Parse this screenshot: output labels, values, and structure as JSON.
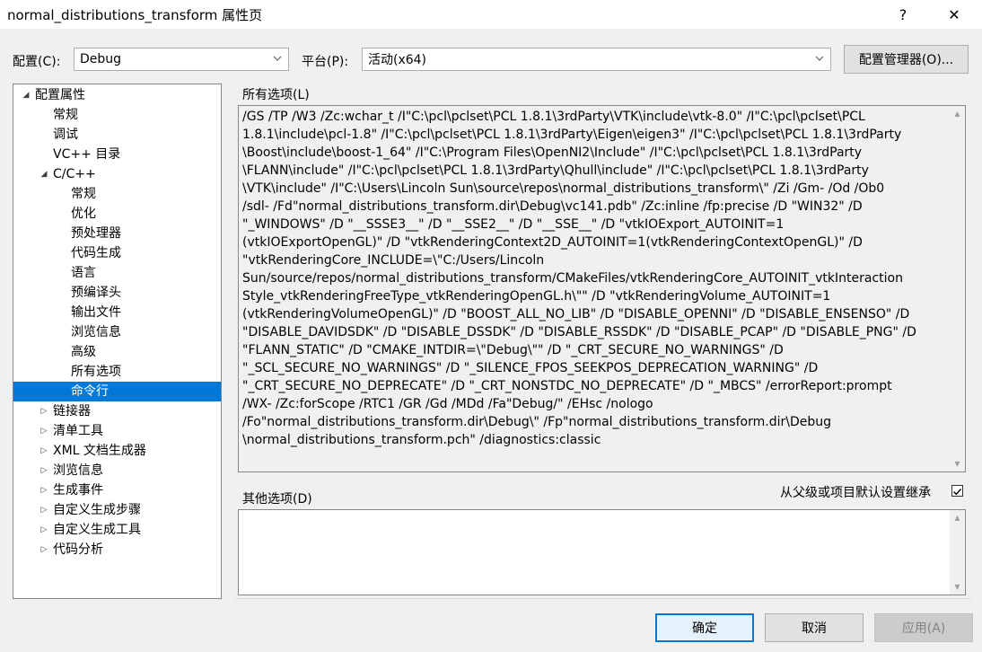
{
  "window": {
    "title": "normal_distributions_transform 属性页",
    "help_label": "?",
    "close_label": "✕"
  },
  "config": {
    "label": "配置(C):",
    "value": "Debug"
  },
  "platform": {
    "label": "平台(P):",
    "value": "活动(x64)"
  },
  "config_manager_label": "配置管理器(O)...",
  "tree": [
    {
      "label": "配置属性",
      "level": 0,
      "exp": "◢"
    },
    {
      "label": "常规",
      "level": 1
    },
    {
      "label": "调试",
      "level": 1
    },
    {
      "label": "VC++ 目录",
      "level": 1
    },
    {
      "label": "C/C++",
      "level": 1,
      "exp": "◢"
    },
    {
      "label": "常规",
      "level": 2
    },
    {
      "label": "优化",
      "level": 2
    },
    {
      "label": "预处理器",
      "level": 2
    },
    {
      "label": "代码生成",
      "level": 2
    },
    {
      "label": "语言",
      "level": 2
    },
    {
      "label": "预编译头",
      "level": 2
    },
    {
      "label": "输出文件",
      "level": 2
    },
    {
      "label": "浏览信息",
      "level": 2
    },
    {
      "label": "高级",
      "level": 2
    },
    {
      "label": "所有选项",
      "level": 2
    },
    {
      "label": "命令行",
      "level": 2,
      "selected": true
    },
    {
      "label": "链接器",
      "level": 1,
      "exp": "▷"
    },
    {
      "label": "清单工具",
      "level": 1,
      "exp": "▷"
    },
    {
      "label": "XML 文档生成器",
      "level": 1,
      "exp": "▷"
    },
    {
      "label": "浏览信息",
      "level": 1,
      "exp": "▷"
    },
    {
      "label": "生成事件",
      "level": 1,
      "exp": "▷"
    },
    {
      "label": "自定义生成步骤",
      "level": 1,
      "exp": "▷"
    },
    {
      "label": "自定义生成工具",
      "level": 1,
      "exp": "▷"
    },
    {
      "label": "代码分析",
      "level": 1,
      "exp": "▷"
    }
  ],
  "all_options": {
    "label": "所有选项(L)",
    "lines": [
      "/GS /TP /W3 /Zc:wchar_t /I\"C:\\pcl\\pclset\\PCL 1.8.1\\3rdParty\\VTK\\include\\vtk-8.0\" /I\"C:\\pcl\\pclset\\PCL",
      "1.8.1\\include\\pcl-1.8\" /I\"C:\\pcl\\pclset\\PCL 1.8.1\\3rdParty\\Eigen\\eigen3\" /I\"C:\\pcl\\pclset\\PCL 1.8.1\\3rdParty",
      "\\Boost\\include\\boost-1_64\" /I\"C:\\Program Files\\OpenNI2\\Include\" /I\"C:\\pcl\\pclset\\PCL 1.8.1\\3rdParty",
      "\\FLANN\\include\" /I\"C:\\pcl\\pclset\\PCL 1.8.1\\3rdParty\\Qhull\\include\" /I\"C:\\pcl\\pclset\\PCL 1.8.1\\3rdParty",
      "\\VTK\\include\" /I\"C:\\Users\\Lincoln Sun\\source\\repos\\normal_distributions_transform\\\" /Zi /Gm- /Od /Ob0",
      "/sdl- /Fd\"normal_distributions_transform.dir\\Debug\\vc141.pdb\" /Zc:inline /fp:precise /D \"WIN32\" /D",
      "\"_WINDOWS\" /D \"__SSSE3__\" /D \"__SSE2__\" /D \"__SSE__\" /D \"vtkIOExport_AUTOINIT=1",
      "(vtkIOExportOpenGL)\" /D \"vtkRenderingContext2D_AUTOINIT=1(vtkRenderingContextOpenGL)\" /D",
      "\"vtkRenderingCore_INCLUDE=\\\"C:/Users/Lincoln",
      "Sun/source/repos/normal_distributions_transform/CMakeFiles/vtkRenderingCore_AUTOINIT_vtkInteraction",
      "Style_vtkRenderingFreeType_vtkRenderingOpenGL.h\\\"\" /D \"vtkRenderingVolume_AUTOINIT=1",
      "(vtkRenderingVolumeOpenGL)\" /D \"BOOST_ALL_NO_LIB\" /D \"DISABLE_OPENNI\" /D \"DISABLE_ENSENSO\" /D",
      "\"DISABLE_DAVIDSDK\" /D \"DISABLE_DSSDK\" /D \"DISABLE_RSSDK\" /D \"DISABLE_PCAP\" /D \"DISABLE_PNG\" /D",
      "\"FLANN_STATIC\" /D \"CMAKE_INTDIR=\\\"Debug\\\"\" /D \"_CRT_SECURE_NO_WARNINGS\" /D",
      "\"_SCL_SECURE_NO_WARNINGS\" /D \"_SILENCE_FPOS_SEEKPOS_DEPRECATION_WARNING\" /D",
      "\"_CRT_SECURE_NO_DEPRECATE\" /D \"_CRT_NONSTDC_NO_DEPRECATE\" /D \"_MBCS\" /errorReport:prompt",
      "/WX- /Zc:forScope /RTC1 /GR /Gd /MDd /Fa\"Debug/\" /EHsc /nologo",
      "/Fo\"normal_distributions_transform.dir\\Debug\\\" /Fp\"normal_distributions_transform.dir\\Debug",
      "\\normal_distributions_transform.pch\" /diagnostics:classic"
    ]
  },
  "other_options": {
    "label": "其他选项(D)",
    "value": ""
  },
  "inherit": {
    "label": "从父级或项目默认设置继承",
    "checked": true
  },
  "buttons": {
    "ok": "确定",
    "cancel": "取消",
    "apply": "应用(A)"
  }
}
